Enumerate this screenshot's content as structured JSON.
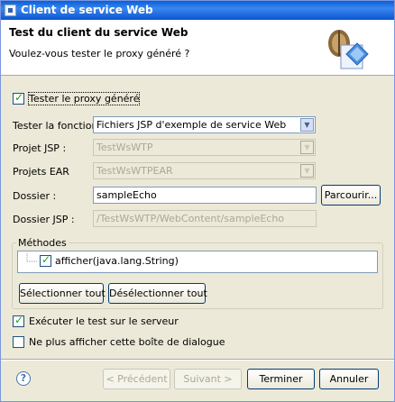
{
  "window": {
    "title": "Client de service Web"
  },
  "banner": {
    "heading": "Test du client du service Web",
    "description": "Voulez-vous tester le proxy généré ?"
  },
  "test_proxy": {
    "label": "Tester le proxy généré",
    "checked": true
  },
  "form": {
    "function_label": "Tester la fonction",
    "function_value": "Fichiers JSP d'exemple de service Web",
    "jsp_project_label": "Projet JSP :",
    "jsp_project_value": "TestWsWTP",
    "ear_projects_label": "Projets EAR",
    "ear_projects_value": "TestWsWTPEAR",
    "folder_label": "Dossier :",
    "folder_value": "sampleEcho",
    "browse_label": "Parcourir...",
    "jsp_folder_label": "Dossier JSP :",
    "jsp_folder_value": "/TestWsWTP/WebContent/sampleEcho"
  },
  "methods": {
    "title": "Méthodes",
    "items": [
      {
        "label": "afficher(java.lang.String)",
        "checked": true
      }
    ],
    "select_all_label": "Sélectionner tout",
    "deselect_all_label": "Désélectionner tout"
  },
  "options": {
    "run_on_server_label": "Exécuter le test sur le serveur",
    "run_on_server_checked": true,
    "dont_show_label": "Ne plus afficher cette boîte de dialogue",
    "dont_show_checked": false
  },
  "footer": {
    "back_label": "< Précédent",
    "next_label": "Suivant >",
    "finish_label": "Terminer",
    "cancel_label": "Annuler"
  },
  "icons": [
    "app-icon",
    "wizard-banner-icon",
    "help-icon",
    "dropdown-arrow-icon"
  ]
}
